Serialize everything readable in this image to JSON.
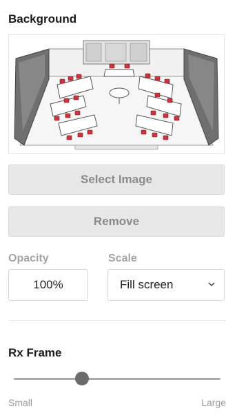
{
  "background": {
    "title": "Background",
    "preview_image": "office-floorplan-illustration",
    "select_button_label": "Select Image",
    "remove_button_label": "Remove"
  },
  "opacity": {
    "label": "Opacity",
    "value": "100%"
  },
  "scale": {
    "label": "Scale",
    "selected": "Fill screen",
    "icon": "chevron-down-icon"
  },
  "rx_frame": {
    "title": "Rx Frame",
    "slider_value": 0.33,
    "min_label": "Small",
    "max_label": "Large"
  },
  "colors": {
    "accent_red": "#d2313c",
    "button_bg": "#e7e7e7",
    "button_text": "#8a8a8a",
    "slider_thumb": "#6b6b6b"
  }
}
